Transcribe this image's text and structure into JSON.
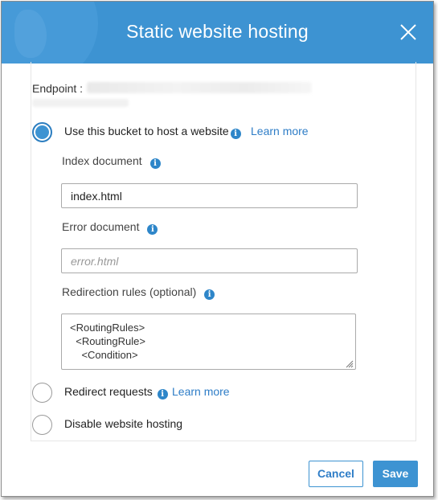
{
  "dialog": {
    "title": "Static website hosting",
    "close_icon": "close-icon"
  },
  "endpoint": {
    "label": "Endpoint :"
  },
  "options": {
    "host": {
      "label": "Use this bucket to host a website",
      "learn_more": "Learn more",
      "selected": true
    },
    "redirect": {
      "label": "Redirect requests",
      "learn_more": "Learn more",
      "selected": false
    },
    "disable": {
      "label": "Disable website hosting",
      "selected": false
    }
  },
  "fields": {
    "index_document": {
      "label": "Index document",
      "value": "index.html"
    },
    "error_document": {
      "label": "Error document",
      "placeholder": "error.html",
      "value": ""
    },
    "redirection_rules": {
      "label": "Redirection rules (optional)",
      "value": "<RoutingRules>\n  <RoutingRule>\n    <Condition>"
    }
  },
  "buttons": {
    "cancel": "Cancel",
    "save": "Save"
  },
  "colors": {
    "header": "#3d93d2",
    "link": "#2e7dc7",
    "info_icon": "#2e86c9"
  }
}
